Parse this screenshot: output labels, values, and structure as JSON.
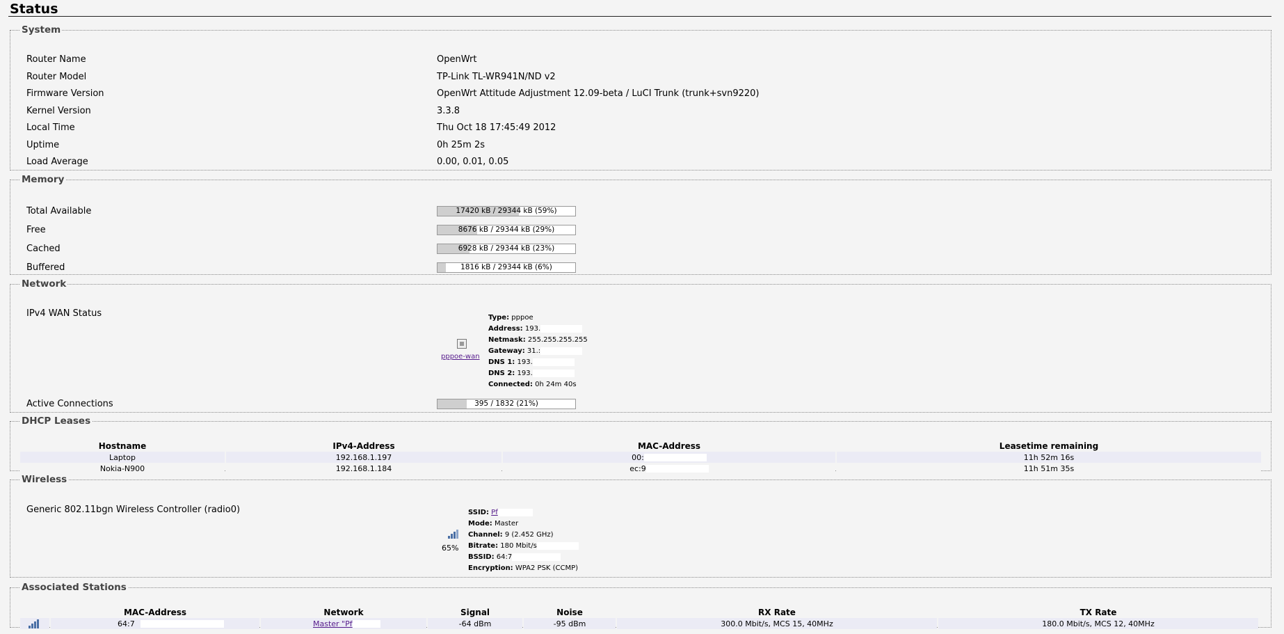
{
  "page": {
    "title": "Status"
  },
  "system": {
    "legend": "System",
    "rows": [
      {
        "label": "Router Name",
        "value": "OpenWrt"
      },
      {
        "label": "Router Model",
        "value": "TP-Link TL-WR941N/ND v2"
      },
      {
        "label": "Firmware Version",
        "value": "OpenWrt Attitude Adjustment 12.09-beta / LuCI Trunk (trunk+svn9220)"
      },
      {
        "label": "Kernel Version",
        "value": "3.3.8"
      },
      {
        "label": "Local Time",
        "value": "Thu Oct 18 17:45:49 2012"
      },
      {
        "label": "Uptime",
        "value": "0h 25m 2s"
      },
      {
        "label": "Load Average",
        "value": "0.00, 0.01, 0.05"
      }
    ]
  },
  "memory": {
    "legend": "Memory",
    "rows": [
      {
        "label": "Total Available",
        "text": "17420 kB / 29344 kB (59%)",
        "percent": 59
      },
      {
        "label": "Free",
        "text": "8676 kB / 29344 kB (29%)",
        "percent": 29
      },
      {
        "label": "Cached",
        "text": "6928 kB / 29344 kB (23%)",
        "percent": 23
      },
      {
        "label": "Buffered",
        "text": "1816 kB / 29344 kB (6%)",
        "percent": 6
      }
    ]
  },
  "network": {
    "legend": "Network",
    "wan_label": "IPv4 WAN Status",
    "iface_link": "pppoe-wan",
    "iface_icon": "ethernet-port-icon",
    "wan": {
      "type_key": "Type:",
      "type": "pppoe",
      "address_key": "Address:",
      "address": "193.",
      "netmask_key": "Netmask:",
      "netmask": "255.255.255.255",
      "gateway_key": "Gateway:",
      "gateway": "31.:",
      "dns1_key": "DNS 1:",
      "dns1": "193.",
      "dns2_key": "DNS 2:",
      "dns2": "193.",
      "connected_key": "Connected:",
      "connected": "0h 24m 40s"
    },
    "connections_label": "Active Connections",
    "connections_text": "395 / 1832 (21%)",
    "connections_percent": 21
  },
  "dhcp": {
    "legend": "DHCP Leases",
    "headers": [
      "Hostname",
      "IPv4-Address",
      "MAC-Address",
      "Leasetime remaining"
    ],
    "rows": [
      {
        "hostname": "Laptop",
        "ip": "192.168.1.197",
        "mac": "00:",
        "lease": "11h 52m 16s"
      },
      {
        "hostname": "Nokia-N900",
        "ip": "192.168.1.184",
        "mac": "ec:9",
        "lease": "11h 51m 35s"
      }
    ]
  },
  "wireless": {
    "legend": "Wireless",
    "device": "Generic 802.11bgn Wireless Controller (radio0)",
    "signal_icon": "signal-strength-icon",
    "signal_percent": "65%",
    "ssid_key": "SSID:",
    "ssid": "Pf",
    "mode_key": "Mode:",
    "mode": "Master",
    "channel_key": "Channel:",
    "channel": "9 (2.452 GHz)",
    "bitrate_key": "Bitrate:",
    "bitrate": "180 Mbit/s",
    "bssid_key": "BSSID:",
    "bssid": "64:7",
    "encryption_key": "Encryption:",
    "encryption": "WPA2 PSK (CCMP)"
  },
  "stations": {
    "legend": "Associated Stations",
    "headers": [
      "MAC-Address",
      "Network",
      "Signal",
      "Noise",
      "RX Rate",
      "TX Rate"
    ],
    "rows": [
      {
        "mac": "64:7",
        "network": "Master \"Pf",
        "signal": "-64 dBm",
        "noise": "-95 dBm",
        "rx": "300.0 Mbit/s, MCS 15, 40MHz",
        "tx": "180.0 Mbit/s, MCS 12, 40MHz"
      }
    ]
  }
}
